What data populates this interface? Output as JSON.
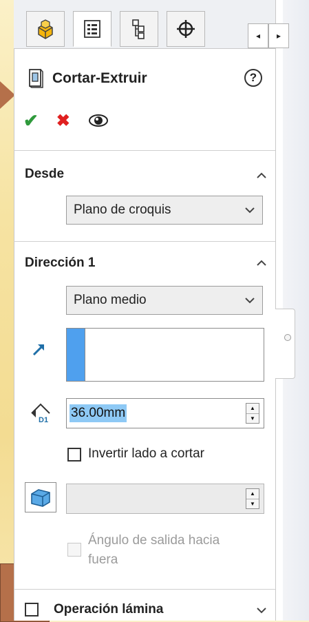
{
  "tabs": [
    {
      "name": "FeatureManager",
      "icon": "feature-manager-icon"
    },
    {
      "name": "PropertyManager",
      "icon": "property-manager-icon",
      "active": true
    },
    {
      "name": "ConfigurationManager",
      "icon": "configuration-manager-icon"
    },
    {
      "name": "DimXpertManager",
      "icon": "dimxpert-manager-icon"
    }
  ],
  "scroll": {
    "left": "◂",
    "right": "▸"
  },
  "feature": {
    "title": "Cortar-Extruir",
    "help": "?"
  },
  "actions": {
    "ok": "✔",
    "cancel": "✖"
  },
  "desde": {
    "heading": "Desde",
    "selected": "Plano de croquis"
  },
  "direccion1": {
    "heading": "Dirección 1",
    "end_condition": "Plano medio",
    "depth_value": "36.00mm",
    "flip_label": "Invertir lado a cortar",
    "draft_label_line1": "Ángulo de salida hacia",
    "draft_label_line2": "fuera"
  },
  "operacion": {
    "heading": "Operación lámina"
  },
  "colors": {
    "accent": "#4fa0ee",
    "ok": "#2f9a3c",
    "cancel": "#e02020"
  }
}
